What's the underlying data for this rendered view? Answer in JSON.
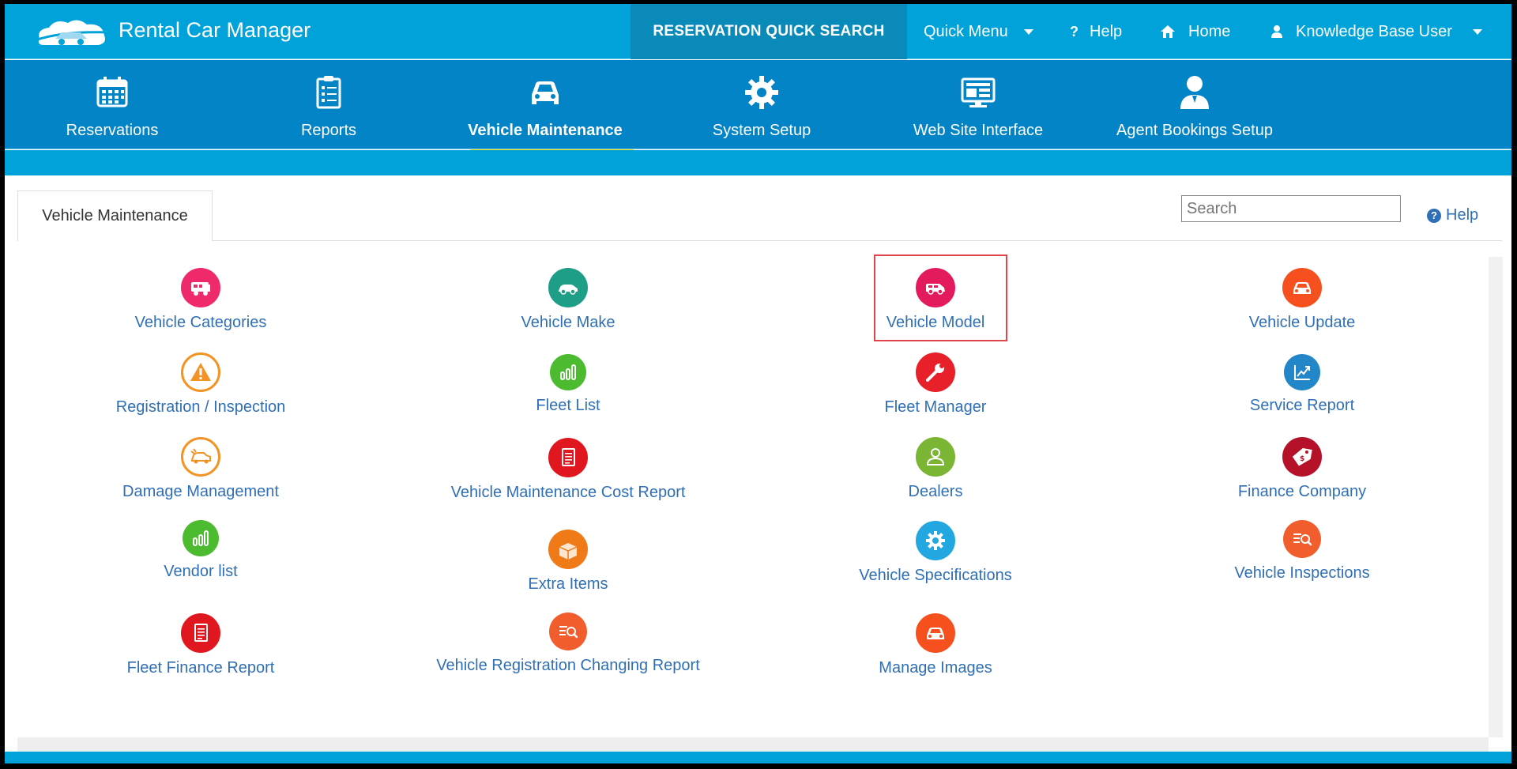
{
  "app": {
    "title": "Rental Car Manager"
  },
  "topbar": {
    "quick_search": "RESERVATION QUICK SEARCH",
    "quick_menu": "Quick Menu",
    "help": "Help",
    "home": "Home",
    "user": "Knowledge Base User"
  },
  "nav": [
    {
      "label": "Reservations",
      "icon": "calendar-icon"
    },
    {
      "label": "Reports",
      "icon": "clipboard-icon"
    },
    {
      "label": "Vehicle Maintenance",
      "icon": "car-icon",
      "active": true
    },
    {
      "label": "System Setup",
      "icon": "gear-icon"
    },
    {
      "label": "Web Site Interface",
      "icon": "monitor-icon"
    },
    {
      "label": "Agent Bookings Setup",
      "icon": "agent-icon"
    }
  ],
  "content": {
    "tab": "Vehicle Maintenance",
    "search_placeholder": "Search",
    "help": "Help",
    "highlighted_item": "Vehicle Model"
  },
  "items": [
    {
      "label": "Vehicle Categories",
      "icon": "rv-icon",
      "color": "#ee2a6b"
    },
    {
      "label": "Vehicle Make",
      "icon": "car-icon",
      "color": "#1e9e87"
    },
    {
      "label": "Vehicle Model",
      "icon": "van-icon",
      "color": "#e31b5c"
    },
    {
      "label": "Vehicle Update",
      "icon": "car-front-icon",
      "color": "#f5501e"
    },
    {
      "label": "Registration / Inspection",
      "icon": "warning-icon",
      "color": "#f39325"
    },
    {
      "label": "Fleet List",
      "icon": "bar-chart-icon",
      "color": "#4cbb2f"
    },
    {
      "label": "Fleet Manager",
      "icon": "wrench-icon",
      "color": "#e8202a"
    },
    {
      "label": "Service Report",
      "icon": "trend-chart-icon",
      "color": "#2286c9"
    },
    {
      "label": "Damage Management",
      "icon": "car-crash-icon",
      "color": "#f39325"
    },
    {
      "label": "Vehicle Maintenance Cost Report",
      "icon": "document-icon",
      "color": "#e0171f"
    },
    {
      "label": "Dealers",
      "icon": "person-icon",
      "color": "#7ab533"
    },
    {
      "label": "Finance Company",
      "icon": "tag-icon",
      "color": "#b5122a"
    },
    {
      "label": "Vendor list",
      "icon": "bar-chart-icon",
      "color": "#4cbb2f"
    },
    {
      "label": "Extra Items",
      "icon": "box-icon",
      "color": "#f07a18"
    },
    {
      "label": "Vehicle Specifications",
      "icon": "gear-icon",
      "color": "#22a7e0"
    },
    {
      "label": "Vehicle Inspections",
      "icon": "search-list-icon",
      "color": "#f25d2e"
    },
    {
      "label": "Fleet Finance Report",
      "icon": "document-icon",
      "color": "#e0171f"
    },
    {
      "label": "Vehicle Registration Changing Report",
      "icon": "search-list-icon",
      "color": "#f25d2e"
    },
    {
      "label": "Manage Images",
      "icon": "car-front-icon",
      "color": "#f5501e"
    }
  ]
}
